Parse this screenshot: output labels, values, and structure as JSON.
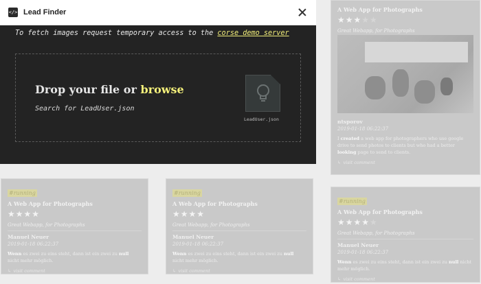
{
  "modal": {
    "title": "Lead Finder",
    "logo_glyph": "</>",
    "notice_prefix": "To fetch images request temporary access to the",
    "notice_link": "corse demo server",
    "drop_text": "Drop your file or",
    "drop_link": "browse",
    "search_hint": "Search for LeadUser.json",
    "file_name": "LeadUser.json",
    "accent": "#f3ef7a",
    "file_icon": "lightbulb-icon"
  },
  "cards": [
    {
      "tag": "",
      "title": "A Web App for Photographs",
      "rating": 3,
      "max": 5,
      "subtitle": "Great Webapp, for Photographs",
      "author": "ntsporov",
      "date": "2019-01-18 06:22:37",
      "body_pre": "I",
      "body_b1": "created",
      "body_mid": "a web app for photographers who use google drive to send photos to clients but who had a better",
      "body_b2": "looking",
      "body_post": "page to send to clients.",
      "link": "visit comment"
    },
    {
      "tag": "#running",
      "title": "A Web App for Photographs",
      "rating": 4,
      "max": 4,
      "subtitle": "Great Webapp, for Photographs",
      "author": "Manuel Neuer",
      "date": "2019-01-18 06:22:37",
      "body_pre": "",
      "body_b1": "Wenn",
      "body_mid": "es zwei zu eins steht, dann ist ein zwei zu",
      "body_b2": "null",
      "body_post": "nicht mehr möglich.",
      "link": "visit comment"
    },
    {
      "tag": "#running",
      "title": "A Web App for Photographs",
      "rating": 4,
      "max": 4,
      "subtitle": "Great Webapp, for Photographs",
      "author": "Manuel Neuer",
      "date": "2019-01-18 06:22:37",
      "body_pre": "",
      "body_b1": "Wenn",
      "body_mid": "es zwei zu eins steht, dann ist ein zwei zu",
      "body_b2": "null",
      "body_post": "nicht mehr möglich.",
      "link": "visit comment"
    },
    {
      "tag": "#running",
      "title": "A Web App for Photographs",
      "rating": 4,
      "max": 5,
      "subtitle": "Great Webapp, for Photographs",
      "author": "Manuel Neuer",
      "date": "2019-01-18 06:22:37",
      "body_pre": "",
      "body_b1": "Wenn",
      "body_mid": "es zwei zu eins steht, dann ist ein zwei zu",
      "body_b2": "null",
      "body_post": "nicht mehr möglich.",
      "link": "visit comment"
    }
  ]
}
